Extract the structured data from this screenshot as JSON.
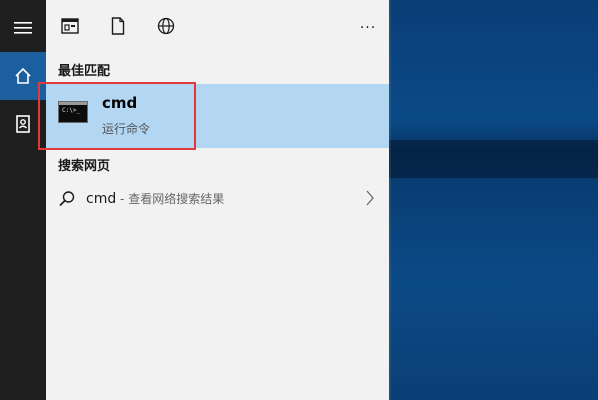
{
  "rail": {
    "items": [
      {
        "icon": "hamburger-menu-icon"
      },
      {
        "icon": "home-icon",
        "active": true
      },
      {
        "icon": "notebook-icon"
      }
    ]
  },
  "toolbar": {
    "icons": [
      "apps-icon",
      "documents-icon",
      "web-icon",
      "more-options-icon"
    ],
    "more_label": "···"
  },
  "best_match": {
    "heading": "最佳匹配",
    "title": "cmd",
    "subtitle": "运行命令",
    "icon_prompt": "C:\\>_",
    "selected": true
  },
  "web_search": {
    "heading": "搜索网页",
    "query": "cmd",
    "hint": " - 查看网络搜索结果"
  },
  "colors": {
    "selected_bg": "#b3d6f2",
    "rail_active": "#1b5f9e",
    "highlight_border": "#e03a3a"
  }
}
